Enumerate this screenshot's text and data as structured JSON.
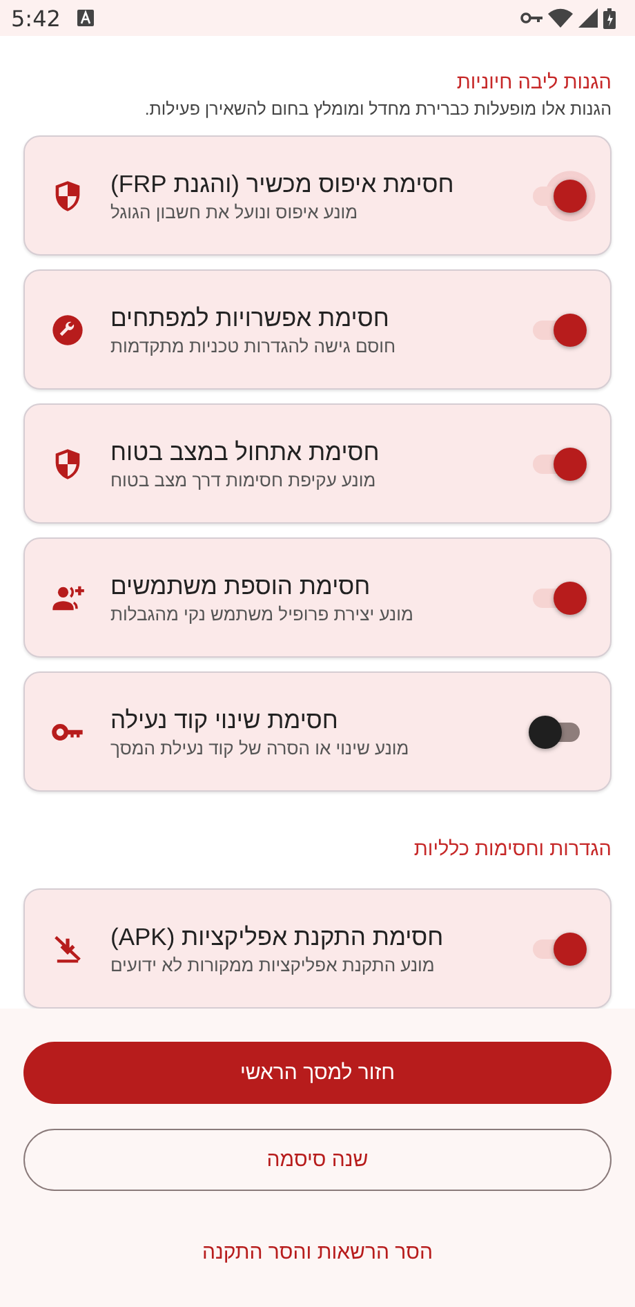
{
  "status_bar": {
    "time": "5:42"
  },
  "sections": [
    {
      "title": "הגנות ליבה חיוניות",
      "subtitle": "הגנות אלו מופעלות כברירת מחדל ומומלץ בחום להשאירן פעילות.",
      "items": [
        {
          "kind": "shield",
          "title": "חסימת איפוס מכשיר (והגנת FRP)",
          "subtitle": "מונע איפוס ונועל את חשבון הגוגל",
          "on": true,
          "focused": true
        },
        {
          "kind": "wrench",
          "title": "חסימת אפשרויות למפתחים",
          "subtitle": "חוסם גישה להגדרות טכניות מתקדמות",
          "on": true,
          "focused": false
        },
        {
          "kind": "shield",
          "title": "חסימת אתחול במצב בטוח",
          "subtitle": "מונע עקיפת חסימות דרך מצב בטוח",
          "on": true,
          "focused": false
        },
        {
          "kind": "user-add",
          "title": "חסימת הוספת משתמשים",
          "subtitle": "מונע יצירת פרופיל משתמש נקי מהגבלות",
          "on": true,
          "focused": false
        },
        {
          "kind": "key",
          "title": "חסימת שינוי קוד נעילה",
          "subtitle": "מונע שינוי או הסרה של קוד נעילת המסך",
          "on": false,
          "focused": false
        }
      ]
    },
    {
      "title": "הגדרות וחסימות כלליות",
      "items": [
        {
          "kind": "install-off",
          "title": "חסימת התקנת אפליקציות (APK)",
          "subtitle": "מונע התקנת אפליקציות ממקורות לא ידועים",
          "on": true,
          "focused": false
        }
      ]
    }
  ],
  "actions": [
    {
      "kind": "filled",
      "label": "חזור למסך הראשי"
    },
    {
      "kind": "outlined",
      "label": "שנה סיסמה"
    },
    {
      "kind": "text",
      "label": "הסר הרשאות והסר התקנה"
    }
  ]
}
